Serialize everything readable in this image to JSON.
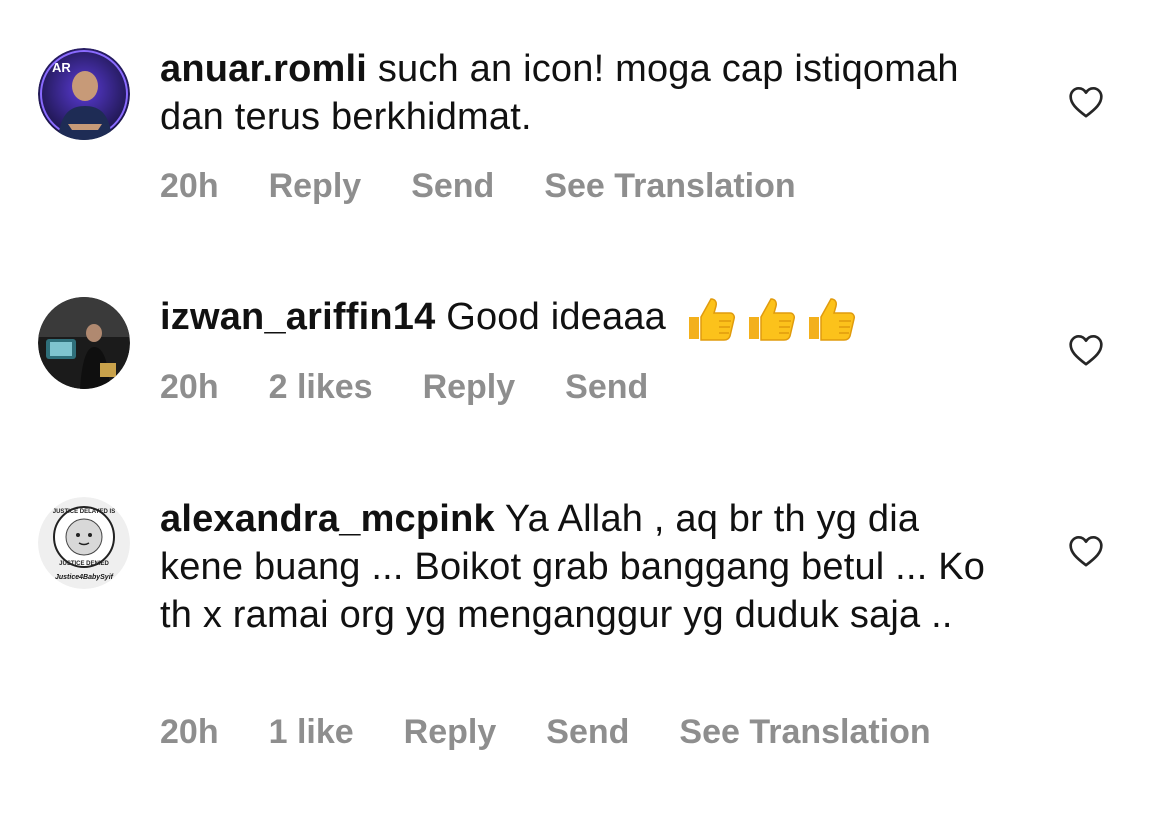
{
  "comments": [
    {
      "username": "anuar.romli",
      "text": "such an icon! moga cap istiqomah dan terus berkhidmat.",
      "time": "20h",
      "likes": "",
      "reply": "Reply",
      "send": "Send",
      "translate": "See Translation",
      "avatar_initials": "AR"
    },
    {
      "username": "izwan_ariffin14",
      "text": "Good ideaaa",
      "emoji": [
        "thumbs-up",
        "thumbs-up",
        "thumbs-up"
      ],
      "time": "20h",
      "likes": "2 likes",
      "reply": "Reply",
      "send": "Send"
    },
    {
      "username": "alexandra_mcpink",
      "text": "Ya Allah , aq br th yg dia kene buang ... Boikot grab banggang betul ... Ko th x ramai org yg menganggur yg duduk saja ..",
      "time": "20h",
      "likes": "1 like",
      "reply": "Reply",
      "send": "Send",
      "translate": "See Translation",
      "avatar_badge_top": "JUSTICE DELAYED IS",
      "avatar_badge_bottom": "JUSTICE DENIED",
      "avatar_caption": "Justice4BabySyif"
    }
  ],
  "colors": {
    "text": "#111111",
    "meta": "#8e8e8e",
    "heart_outline": "#262626"
  },
  "icons": {
    "like": "heart-outline-icon"
  }
}
